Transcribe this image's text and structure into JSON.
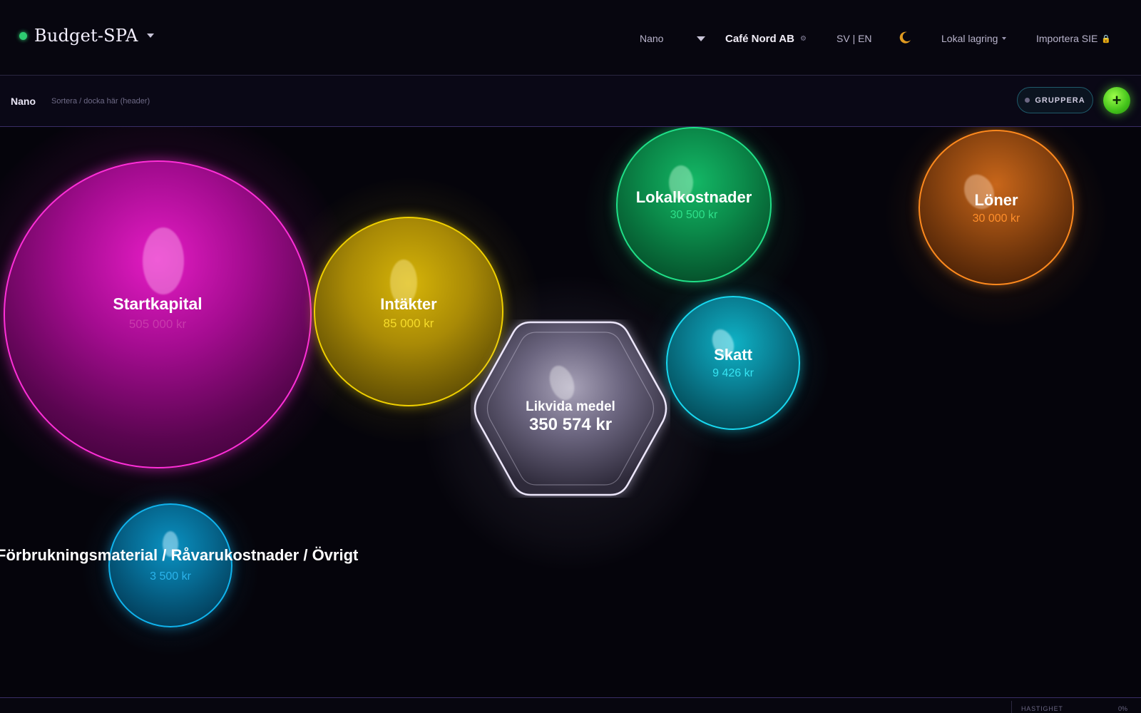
{
  "header": {
    "app_title": "Budget-SPA",
    "level_select": "Nano",
    "company": "Café Nord AB",
    "language": "SV | EN",
    "storage": "Lokal lagring",
    "import": "Importera SIE"
  },
  "toolbar": {
    "level": "Nano",
    "hint": "Sortera / docka här (header)",
    "group_label": "GRUPPERA",
    "add_label": "+"
  },
  "bubbles": {
    "startkapital": {
      "name": "Startkapital",
      "value": "505 000 kr"
    },
    "intakter": {
      "name": "Intäkter",
      "value": "85 000 kr"
    },
    "lokalkostnader": {
      "name": "Lokalkostnader",
      "value": "30 500 kr"
    },
    "loner": {
      "name": "Löner",
      "value": "30 000 kr"
    },
    "skatt": {
      "name": "Skatt",
      "value": "9 426 kr"
    },
    "forbrukning": {
      "name": "Förbrukningsmaterial / Råvarukostnader / Övrigt",
      "value": "3 500 kr"
    },
    "likvida": {
      "name": "Likvida medel",
      "value": "350 574 kr"
    }
  },
  "footer": {
    "speed_label": "HASTIGHET",
    "speed_value": "0%"
  },
  "colors": {
    "startkapital": "#ff2fd8",
    "intakter": "#f0d000",
    "lokalkostnader": "#20e088",
    "loner": "#ff8a1e",
    "skatt": "#18d8f0",
    "forbrukning": "#10b4ee",
    "likvida": "#e4dcf4",
    "accent_green": "#2ecc71"
  },
  "icons": {
    "brand_status": "status-dot-icon",
    "theme": "moon-icon",
    "import_lock": "lock-icon",
    "company_settings": "gear-icon"
  }
}
